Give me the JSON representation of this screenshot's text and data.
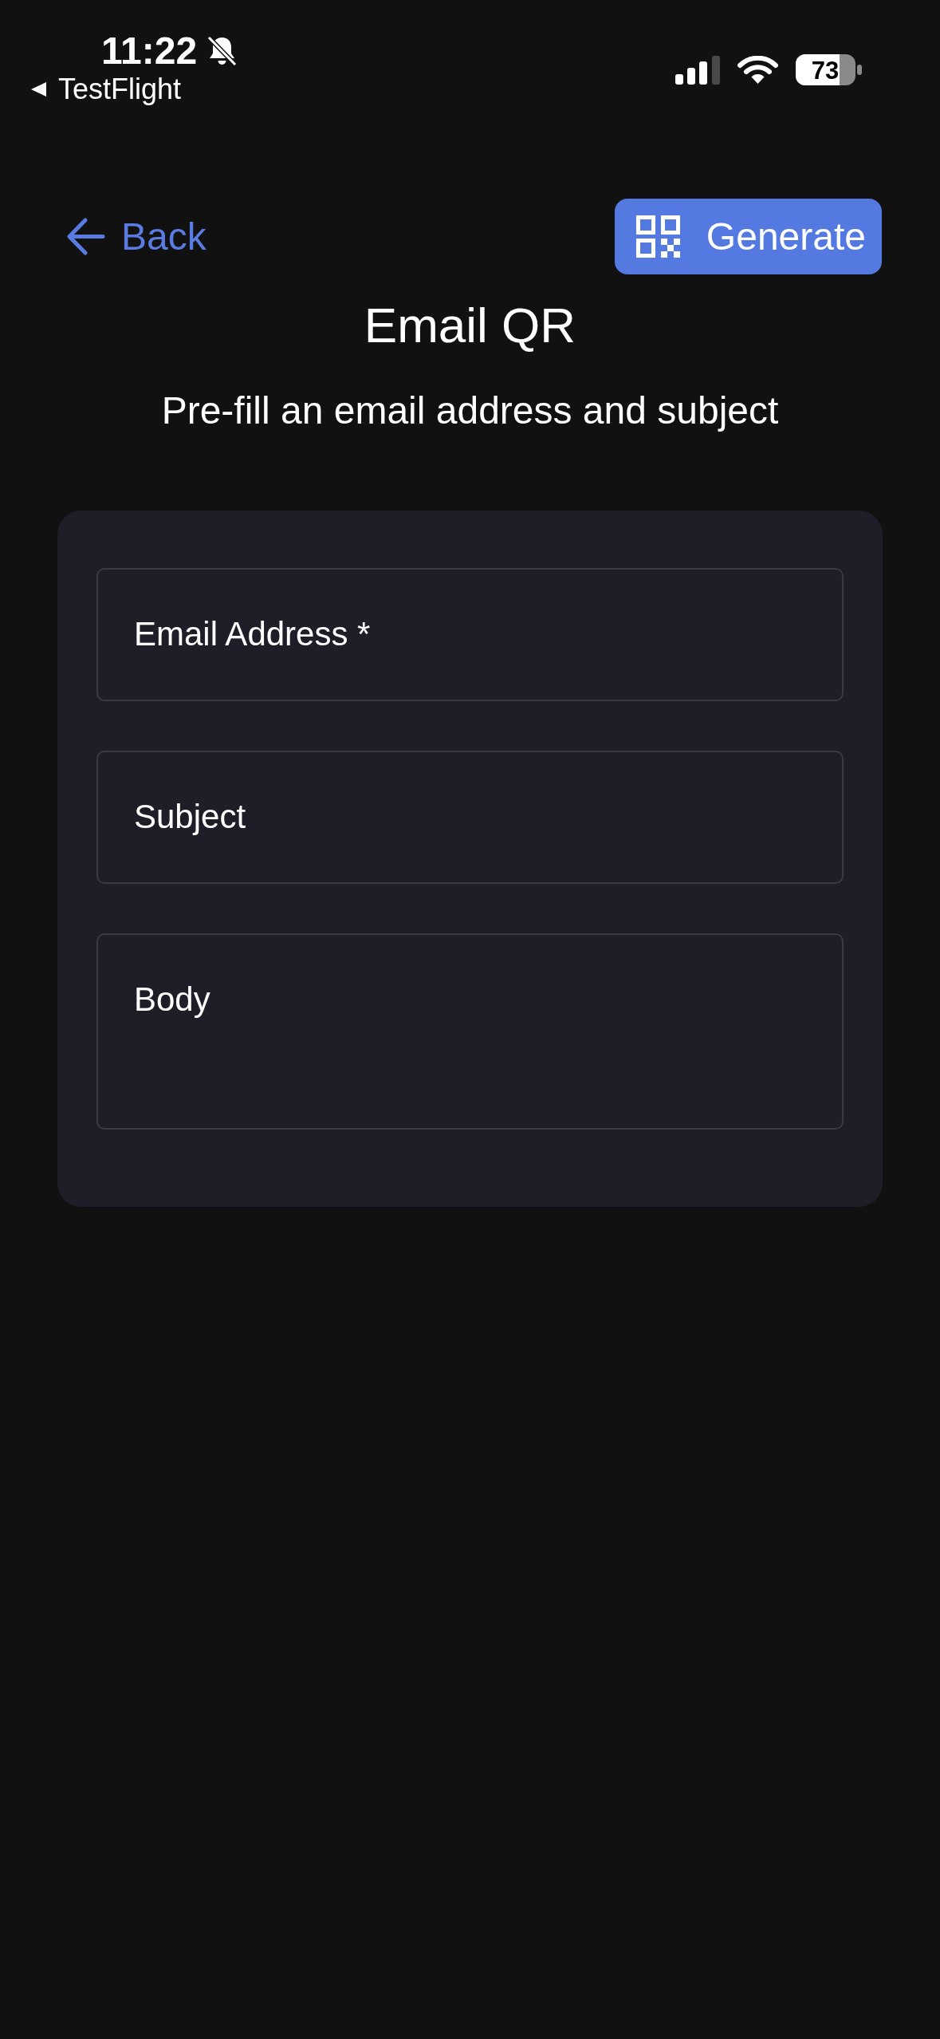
{
  "status_bar": {
    "time": "11:22",
    "back_app": "TestFlight",
    "battery": "73"
  },
  "header": {
    "back": "Back",
    "generate": "Generate"
  },
  "title": "Email QR",
  "subtitle": "Pre-fill an email address and subject",
  "form": {
    "fields": [
      {
        "kind": "text",
        "placeholder": "Email Address *"
      },
      {
        "kind": "text",
        "placeholder": "Subject"
      },
      {
        "kind": "multiline",
        "placeholder": "Body"
      }
    ]
  }
}
